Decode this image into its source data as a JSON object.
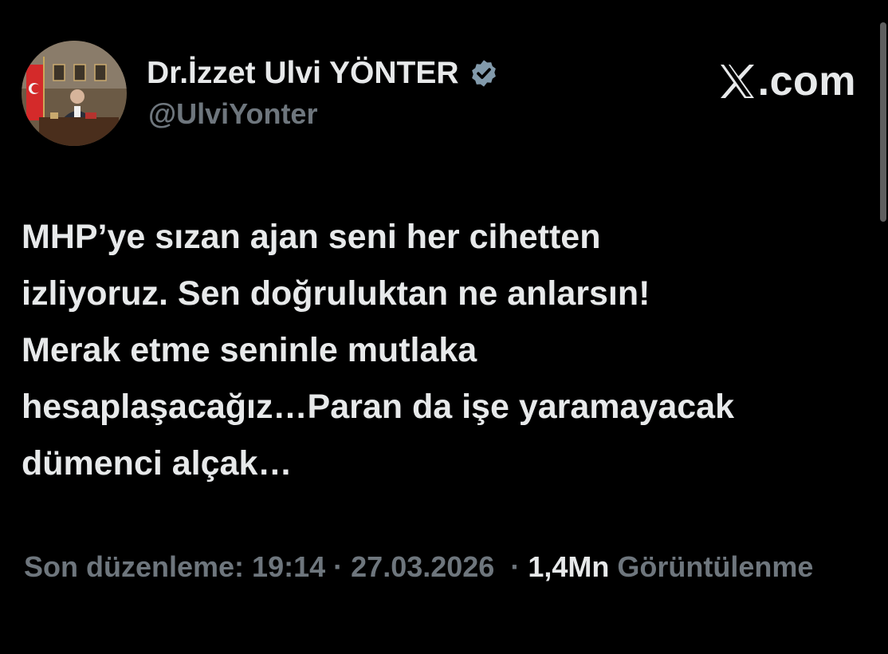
{
  "author": {
    "display_name": "Dr.İzzet Ulvi YÖNTER",
    "handle": "@UlviYonter",
    "verified_icon": "verified-badge-icon",
    "avatar_icon": "profile-avatar"
  },
  "brand": {
    "icon": "x-logo-icon",
    "suffix": ".com"
  },
  "tweet": {
    "text": "MHP’ye sızan ajan seni her cihetten\nizliyoruz. Sen doğruluktan ne anlarsın!\nMerak etme seninle mutlaka\nhesaplaşacağız…Paran da işe yaramayacak\ndümenci alçak…"
  },
  "meta": {
    "edited_label": "Son düzenleme:",
    "time": "19:14",
    "separator": "·",
    "date": "27.03.2026",
    "views_count": "1,4Mn",
    "views_label": "Görüntülenme"
  },
  "colors": {
    "background": "#000000",
    "text_primary": "#e7e9ea",
    "text_secondary": "#6e767d",
    "verified_badge": "#829aab"
  }
}
